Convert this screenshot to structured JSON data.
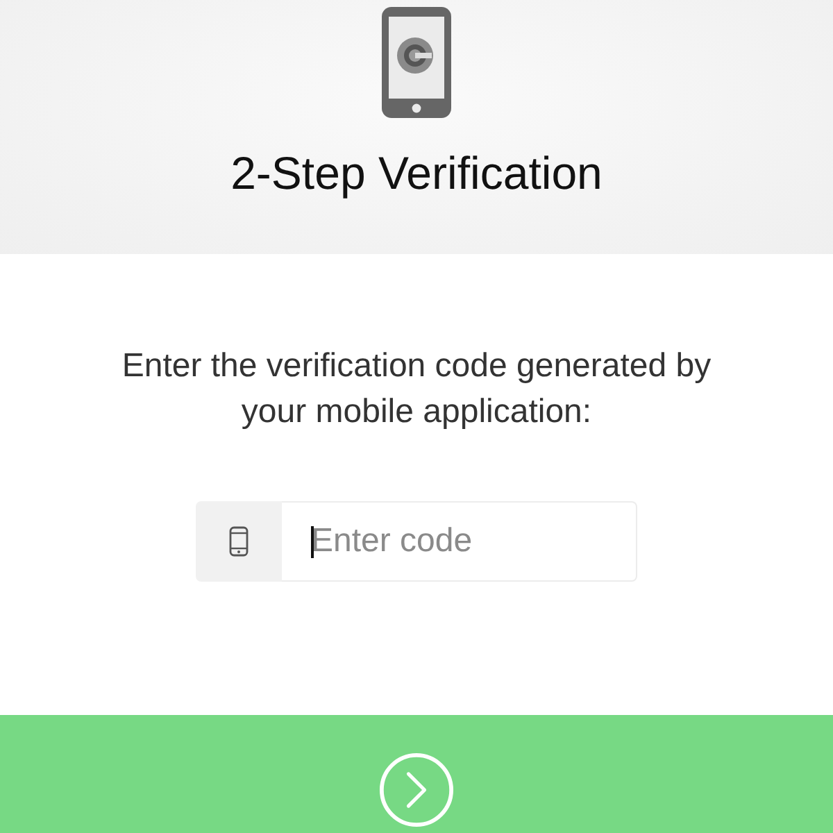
{
  "header": {
    "title": "2-Step Verification"
  },
  "instruction": "Enter the verification code generated by your mobile application:",
  "code_field": {
    "placeholder": "Enter code",
    "focused": true
  },
  "submit_button": {
    "disabled": false
  }
}
